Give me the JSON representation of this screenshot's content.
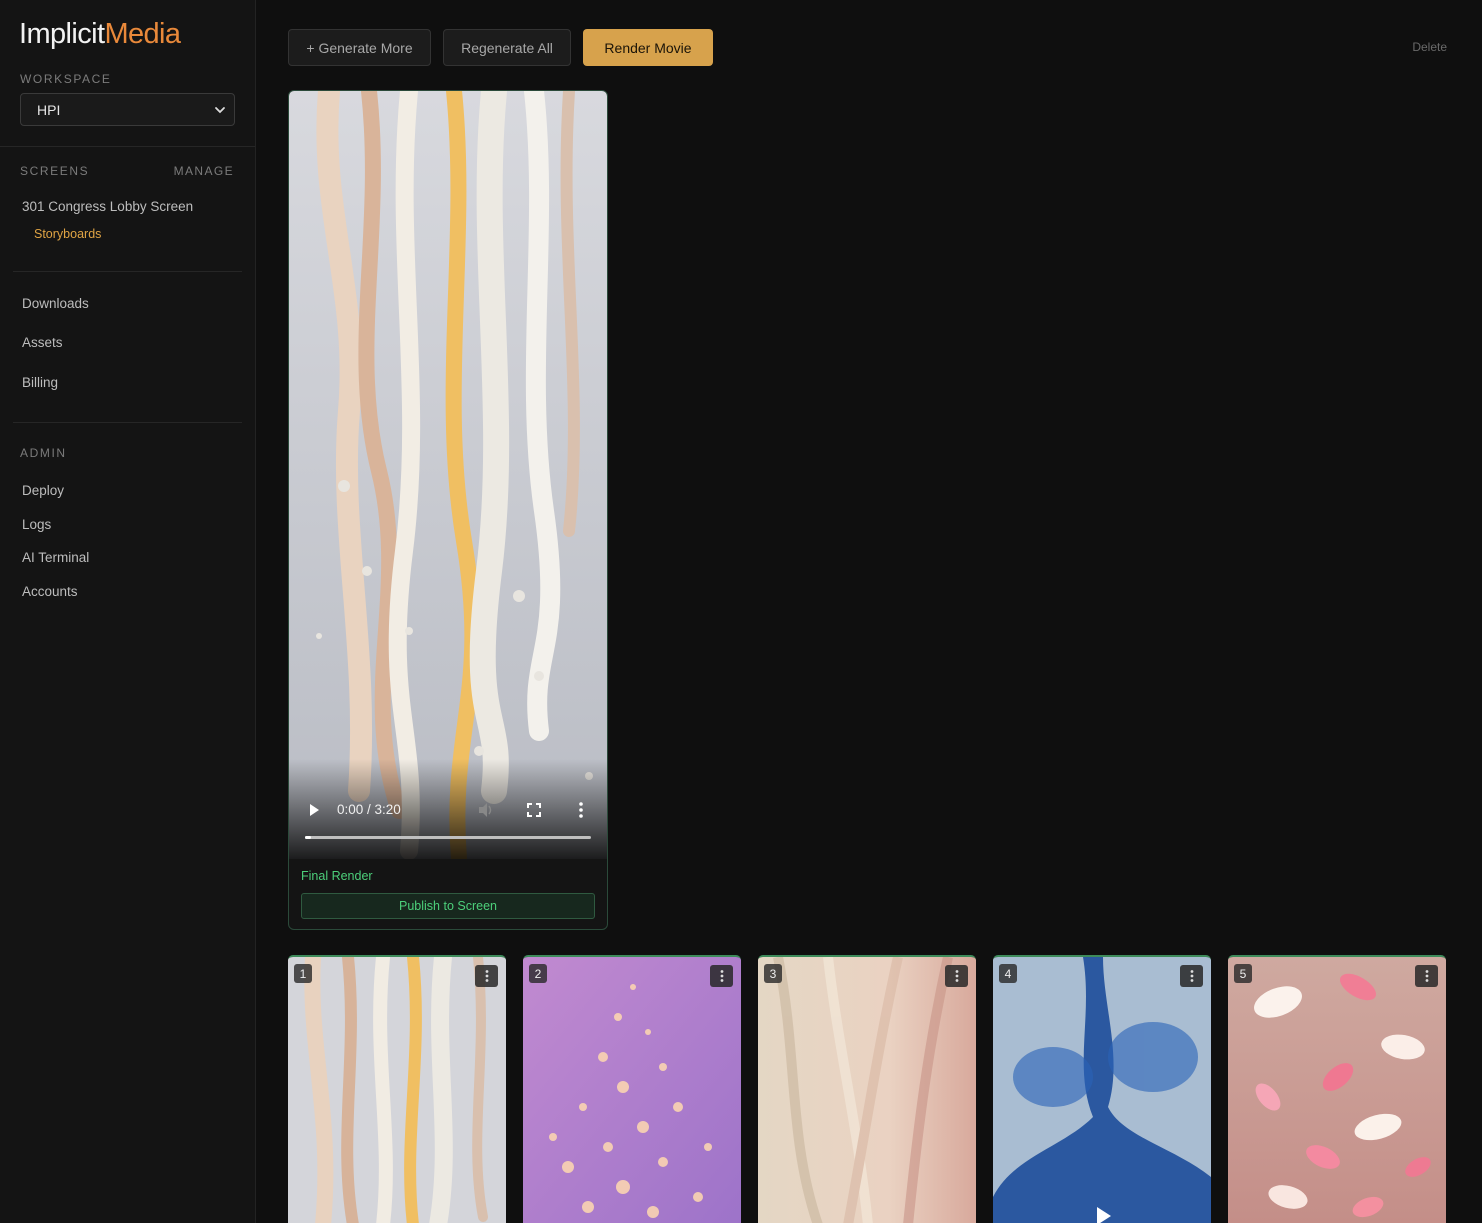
{
  "brand": {
    "part1": "Implicit",
    "part2": "Media",
    "accent_color": "#e9893a"
  },
  "sidebar": {
    "workspace_label": "WORKSPACE",
    "workspace_value": "HPI",
    "screens_label": "SCREENS",
    "manage_label": "MANAGE",
    "screen_name": "301 Congress Lobby Screen",
    "screen_sub": "Storyboards",
    "nav": [
      "Downloads",
      "Assets",
      "Billing"
    ],
    "admin_label": "ADMIN",
    "admin_nav": [
      "Deploy",
      "Logs",
      "AI Terminal",
      "Accounts"
    ]
  },
  "toolbar": {
    "generate_more": "+ Generate More",
    "regenerate_all": "Regenerate All",
    "render_movie": "Render Movie",
    "delete": "Delete",
    "gold_color": "#d7a24c"
  },
  "final": {
    "time": "0:00 / 3:20",
    "progress": 0.0,
    "label": "Final Render",
    "publish": "Publish to Screen",
    "green_color": "#4ccf7a"
  },
  "thumbnails": [
    {
      "num": "1",
      "theme": "paint-drips"
    },
    {
      "num": "2",
      "theme": "purple-bokeh"
    },
    {
      "num": "3",
      "theme": "silk-fabric"
    },
    {
      "num": "4",
      "theme": "blue-ink"
    },
    {
      "num": "5",
      "theme": "rose-petals"
    }
  ]
}
